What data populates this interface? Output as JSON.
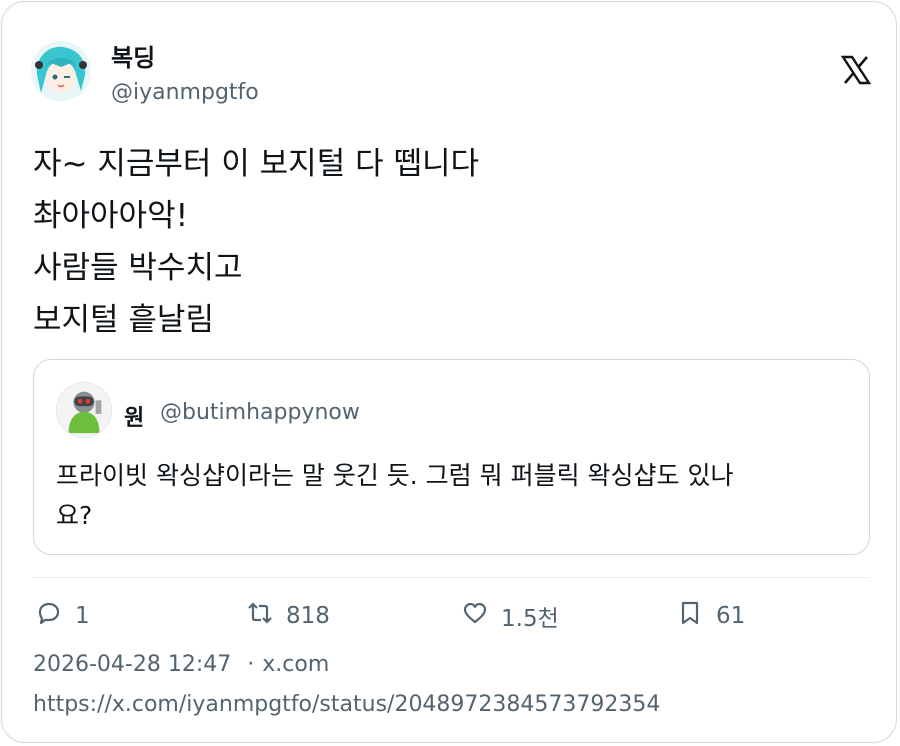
{
  "author": {
    "display_name": "복딩",
    "handle": "@iyanmpgtfo"
  },
  "tweet": {
    "lines": [
      "자~ 지금부터 이 보지털 다 뗍니다",
      "촤아아아악!",
      "사람들 박수치고",
      "보지털 흩날림"
    ]
  },
  "quoted": {
    "display_name": "원",
    "handle": "@butimhappynow",
    "text_line1": "프라이빗 왁싱샵이라는 말 웃긴 듯. 그럼 뭐 퍼블릭 왁싱샵도 있나",
    "text_line2": "요?"
  },
  "actions": {
    "replies": "1",
    "retweets": "818",
    "likes": "1.5천",
    "bookmarks": "61"
  },
  "meta": {
    "datetime": "2026-04-28 12:47",
    "separator": "·",
    "source": "x.com",
    "status_url": "https://x.com/iyanmpgtfo/status/2048972384573792354"
  },
  "icons": {
    "platform": "x-logo-icon",
    "reply": "reply-icon",
    "retweet": "retweet-icon",
    "like": "heart-icon",
    "bookmark": "bookmark-icon"
  },
  "colors": {
    "text_primary": "#0f1419",
    "text_secondary": "#536471",
    "border": "#cfd9de"
  }
}
